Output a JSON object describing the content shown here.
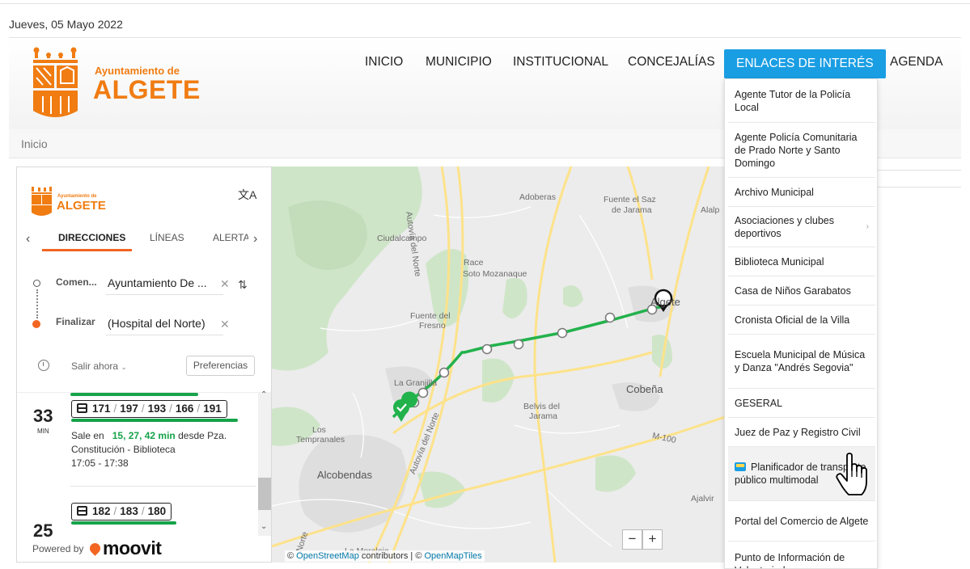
{
  "date": "Jueves, 05 Mayo 2022",
  "brand": {
    "small": "Ayuntamiento de",
    "big": "ALGETE"
  },
  "nav": [
    {
      "label": "INICIO"
    },
    {
      "label": "MUNICIPIO"
    },
    {
      "label": "INSTITUCIONAL"
    },
    {
      "label": "CONCEJALÍAS"
    },
    {
      "label": "ENLACES DE INTERÉS",
      "active": true
    },
    {
      "label": "AGENDA"
    }
  ],
  "breadcrumb": "Inicio",
  "widget": {
    "brand_small": "Ayuntamiento de",
    "brand_big": "ALGETE",
    "tabs": [
      "DIRECCIONES",
      "LÍNEAS",
      "ALERTA"
    ],
    "start_label": "Comen...",
    "start_value": "Ayuntamiento De ...",
    "end_label": "Finalizar",
    "end_value": "(Hospital del Norte)",
    "depart": "Salir ahora",
    "preferences": "Preferencias",
    "results": [
      {
        "minutes": "33",
        "unit": "MIN",
        "routes": [
          "171",
          "197",
          "193",
          "166",
          "191"
        ],
        "leaves_prefix": "Sale en",
        "leaves_times": "15, 27, 42 min",
        "leaves_suffix": "desde Pza.",
        "stop": "Constitución - Biblioteca",
        "time_range": "17:05  -  17:38"
      },
      {
        "minutes": "25",
        "routes": [
          "182",
          "183",
          "180"
        ]
      }
    ],
    "powered_by": "Powered by",
    "moovit": "moovit"
  },
  "map": {
    "labels": {
      "adoberas": "Adoberas",
      "fuente_saz_1": "Fuente el Saz",
      "fuente_saz_2": "de Jarama",
      "alalp": "Alalp",
      "autovia_1": "Autovía del Norte",
      "ciudalcampo": "Ciudalcampo",
      "race_1": "Race",
      "race_2": "Soto Mozanaque",
      "fuente_fresno_1": "Fuente del",
      "fuente_fresno_2": "Fresno",
      "algete": "Algete",
      "cobena": "Cobeña",
      "la_granjilla": "La Granjilla",
      "belvis_1": "Belvis del",
      "belvis_2": "Jarama",
      "los_1": "Los",
      "los_2": "Tempranales",
      "alcobendas": "Alcobendas",
      "autovia_2": "Autovía del Norte",
      "m100": "M-100",
      "ajalvir": "Ajalvir",
      "norte": "Norte",
      "moraleja": "La Moraleja"
    },
    "zoom_out": "−",
    "zoom_in": "+",
    "attribution": {
      "prefix": "©",
      "osm": "OpenStreetMap",
      "mid": "contributors | ©",
      "omt": "OpenMapTiles"
    }
  },
  "dropdown": [
    "Agente Tutor de la Policía Local",
    "Agente Policía Comunitaria de Prado Norte y Santo Domingo",
    "Archivo Municipal",
    "Asociaciones y clubes deportivos",
    "Biblioteca Municipal",
    "Casa de Niños Garabatos",
    "Cronista Oficial de la Villa",
    "Escuela Municipal de Música y Danza \"Andrés Segovia\"",
    "GESERAL",
    "Juez de Paz y Registro Civil",
    "Planificador de transporte público multimodal",
    "Portal del Comercio de Algete",
    "Punto de Información de Voluntariado"
  ],
  "colors": {
    "accent": "#1a9ee3",
    "brand": "#f07c12",
    "route": "#16a34a",
    "moovit": "#f26522"
  }
}
